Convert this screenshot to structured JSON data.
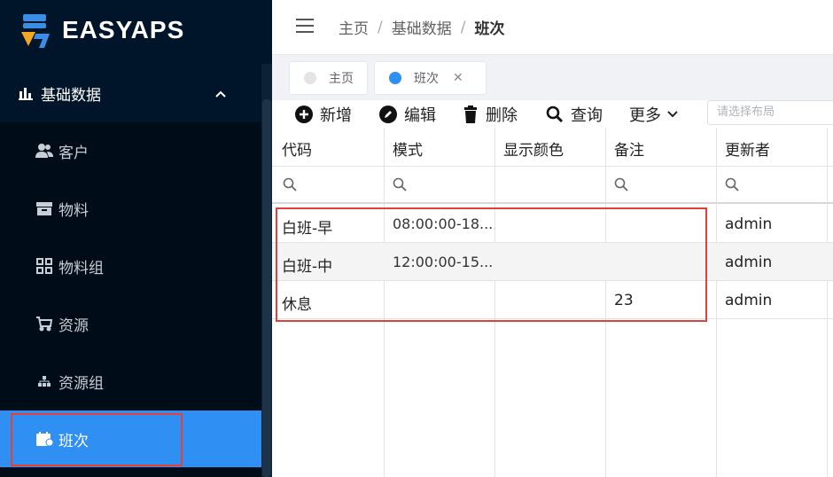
{
  "app": {
    "logo_text": "EASYAPS"
  },
  "sidebar": {
    "group": {
      "label": "基础数据"
    },
    "items": [
      {
        "label": "客户",
        "icon": "users-icon"
      },
      {
        "label": "物料",
        "icon": "box-icon"
      },
      {
        "label": "物料组",
        "icon": "grid-icon"
      },
      {
        "label": "资源",
        "icon": "cart-icon"
      },
      {
        "label": "资源组",
        "icon": "hierarchy-icon"
      },
      {
        "label": "班次",
        "icon": "calendar-icon",
        "active": true
      }
    ]
  },
  "header": {
    "breadcrumb": [
      "主页",
      "基础数据",
      "班次"
    ]
  },
  "tabs": [
    {
      "label": "主页",
      "active": false
    },
    {
      "label": "班次",
      "active": true
    }
  ],
  "toolbar": {
    "add_label": "新增",
    "edit_label": "编辑",
    "delete_label": "删除",
    "query_label": "查询",
    "more_label": "更多",
    "layout_placeholder": "请选择布局"
  },
  "table": {
    "columns": [
      "代码",
      "模式",
      "显示颜色",
      "备注",
      "更新者"
    ],
    "rows": [
      {
        "code": "白班-早",
        "mode": "08:00:00-18...",
        "color": "",
        "note": "",
        "updater": "admin"
      },
      {
        "code": "白班-中",
        "mode": "12:00:00-15...",
        "color": "",
        "note": "",
        "updater": "admin"
      },
      {
        "code": "休息",
        "mode": "",
        "color": "",
        "note": "23",
        "updater": "admin"
      }
    ]
  },
  "colors": {
    "sidebar_bg": "#001529",
    "active_item": "#2f8ff2",
    "highlight_border": "#e0413f",
    "tab_dot_active": "#2f8ff2"
  }
}
